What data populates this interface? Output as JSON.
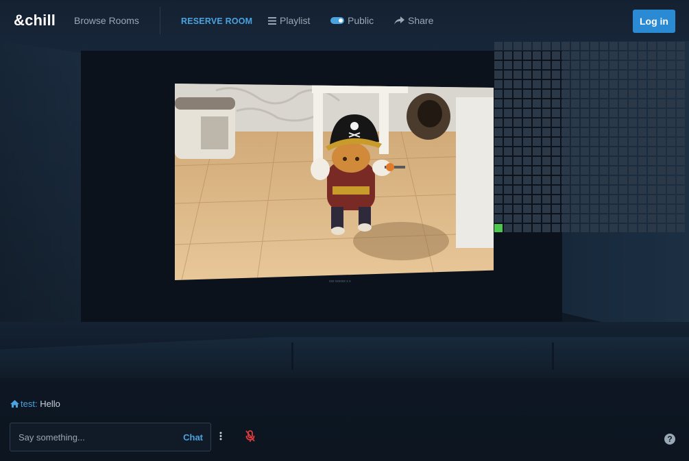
{
  "brand": "&chill",
  "nav": {
    "browse_rooms": "Browse Rooms",
    "reserve_room": "RESERVE ROOM",
    "playlist": "Playlist",
    "public": "Public",
    "share": "Share",
    "login": "Log in"
  },
  "video": {
    "caption": "xxx xxxxxx x x"
  },
  "chat": {
    "messages": [
      {
        "user": "test",
        "separator": ":",
        "text": "Hello"
      }
    ],
    "input_placeholder": "Say something...",
    "send_label": "Chat"
  },
  "help": "?",
  "colors": {
    "accent": "#4aa3df",
    "login_button": "#2a8ad4",
    "occupied_seat": "#4cc94c",
    "empty_seat": "#2a3848",
    "mic_muted": "#e03a3a"
  },
  "icons": {
    "playlist": "bars-icon",
    "public": "toggle-on-icon",
    "share": "share-icon",
    "chat_user": "home-icon",
    "more": "ellipsis-vertical-icon",
    "mic": "microphone-slash-icon",
    "help": "question-circle-icon"
  },
  "seating": {
    "blocks": [
      {
        "rows": 10,
        "cols": 10
      },
      {
        "rows": 10,
        "cols": 10
      },
      {
        "rows": 10,
        "cols": 10
      },
      {
        "rows": 10,
        "cols": 10
      }
    ],
    "occupied": [
      {
        "block": 2,
        "row": 9,
        "col": 0
      }
    ]
  }
}
